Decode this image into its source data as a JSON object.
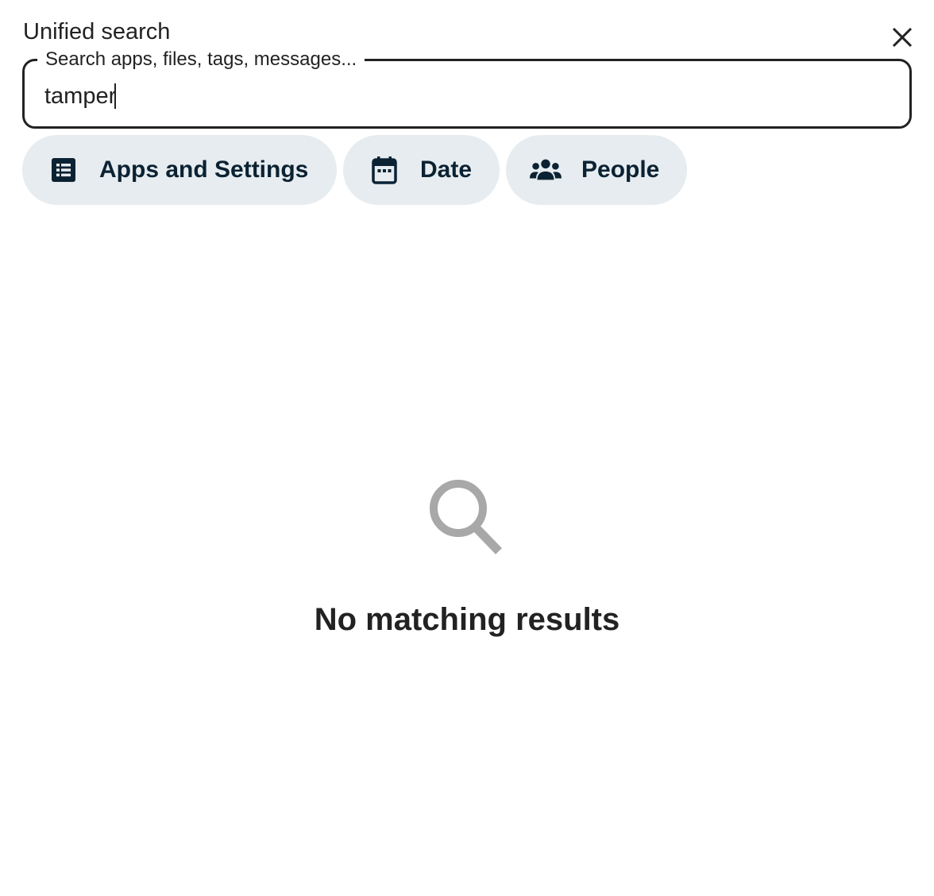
{
  "dialog": {
    "title": "Unified search"
  },
  "search": {
    "label": "Search apps, files, tags, messages...",
    "value": "tamper"
  },
  "filters": [
    {
      "label": "Apps and Settings",
      "icon": "list-box-icon"
    },
    {
      "label": "Date",
      "icon": "calendar-icon"
    },
    {
      "label": "People",
      "icon": "people-icon"
    }
  ],
  "empty_state": {
    "icon": "magnify-icon",
    "message": "No matching results"
  },
  "colors": {
    "chip_background": "#e6ecef",
    "chip_text": "#0b2233",
    "text": "#222222",
    "empty_icon": "#a8a8a8"
  }
}
